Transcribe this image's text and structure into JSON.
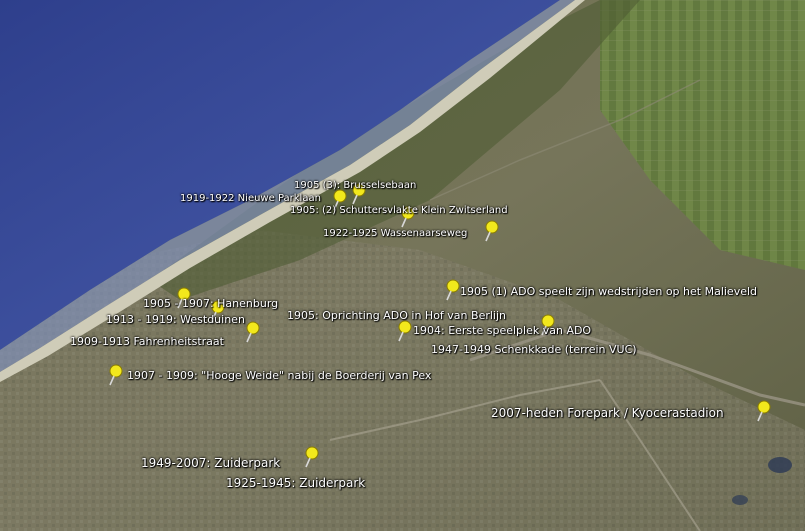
{
  "map": {
    "colors": {
      "sea": "#3c4d9a",
      "sea_light": "#6a76b8",
      "beach": "#c9c7b4",
      "dunes": "#5d6a3c",
      "urban": "#7c7b6a",
      "fields": "#5f7a3a",
      "pin": "#f2e81c"
    },
    "icons": [
      "yellow-pushpin-icon"
    ]
  },
  "placemarks": [
    {
      "label": "1905 (3): Brusselsebaan"
    },
    {
      "label": "1919-1922 Nieuwe Parklaan"
    },
    {
      "label": "1905: (2) Schuttersvlakte Klein Zwitserland"
    },
    {
      "label": "1922-1925 Wassenaarseweg"
    },
    {
      "label": "1905 (1) ADO speelt zijn wedstrijden op het Malieveld"
    },
    {
      "label": "1905 - 1907:  Hanenburg"
    },
    {
      "label": "1913 - 1919:  Westduinen"
    },
    {
      "label": "1905: Oprichting ADO in Hof van Berlijn"
    },
    {
      "label": "1904: Eerste speelplek van ADO"
    },
    {
      "label": "1909-1913 Fahrenheitstraat"
    },
    {
      "label": "1947-1949 Schenkkade (terrein VUC)"
    },
    {
      "label": "1907 - 1909: \"Hooge Weide\" nabij de Boerderij van Pex"
    },
    {
      "label": "2007-heden Forepark / Kyocerastadion"
    },
    {
      "label": "1949-2007: Zuiderpark"
    },
    {
      "label": "1925-1945: Zuiderpark"
    }
  ]
}
